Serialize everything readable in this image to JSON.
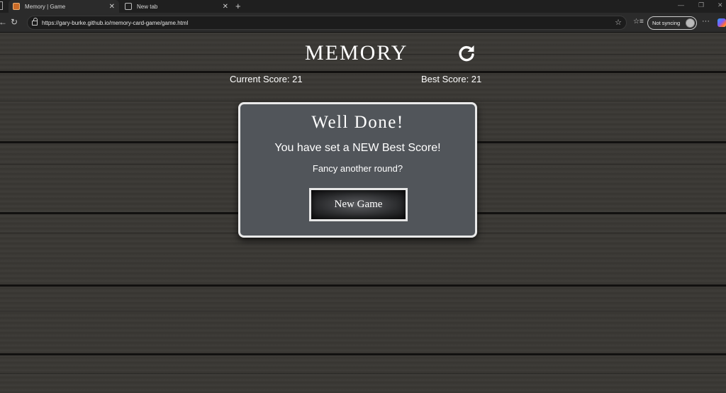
{
  "browser": {
    "tabs": [
      {
        "title": "Memory | Game",
        "active": true
      },
      {
        "title": "New tab",
        "active": false
      }
    ],
    "url": "https://gary-burke.github.io/memory-card-game/game.html",
    "sync_label": "Not syncing"
  },
  "game": {
    "title": "MEMORY",
    "current_score_label": "Current Score: 21",
    "best_score_label": "Best Score: 21"
  },
  "modal": {
    "heading": "Well Done!",
    "message": "You have set a NEW Best Score!",
    "prompt": "Fancy another round?",
    "button_label": "New Game"
  },
  "colors": {
    "wood": "#3b3935",
    "modal_bg": "#51555a",
    "modal_border": "#e9e9e9"
  }
}
